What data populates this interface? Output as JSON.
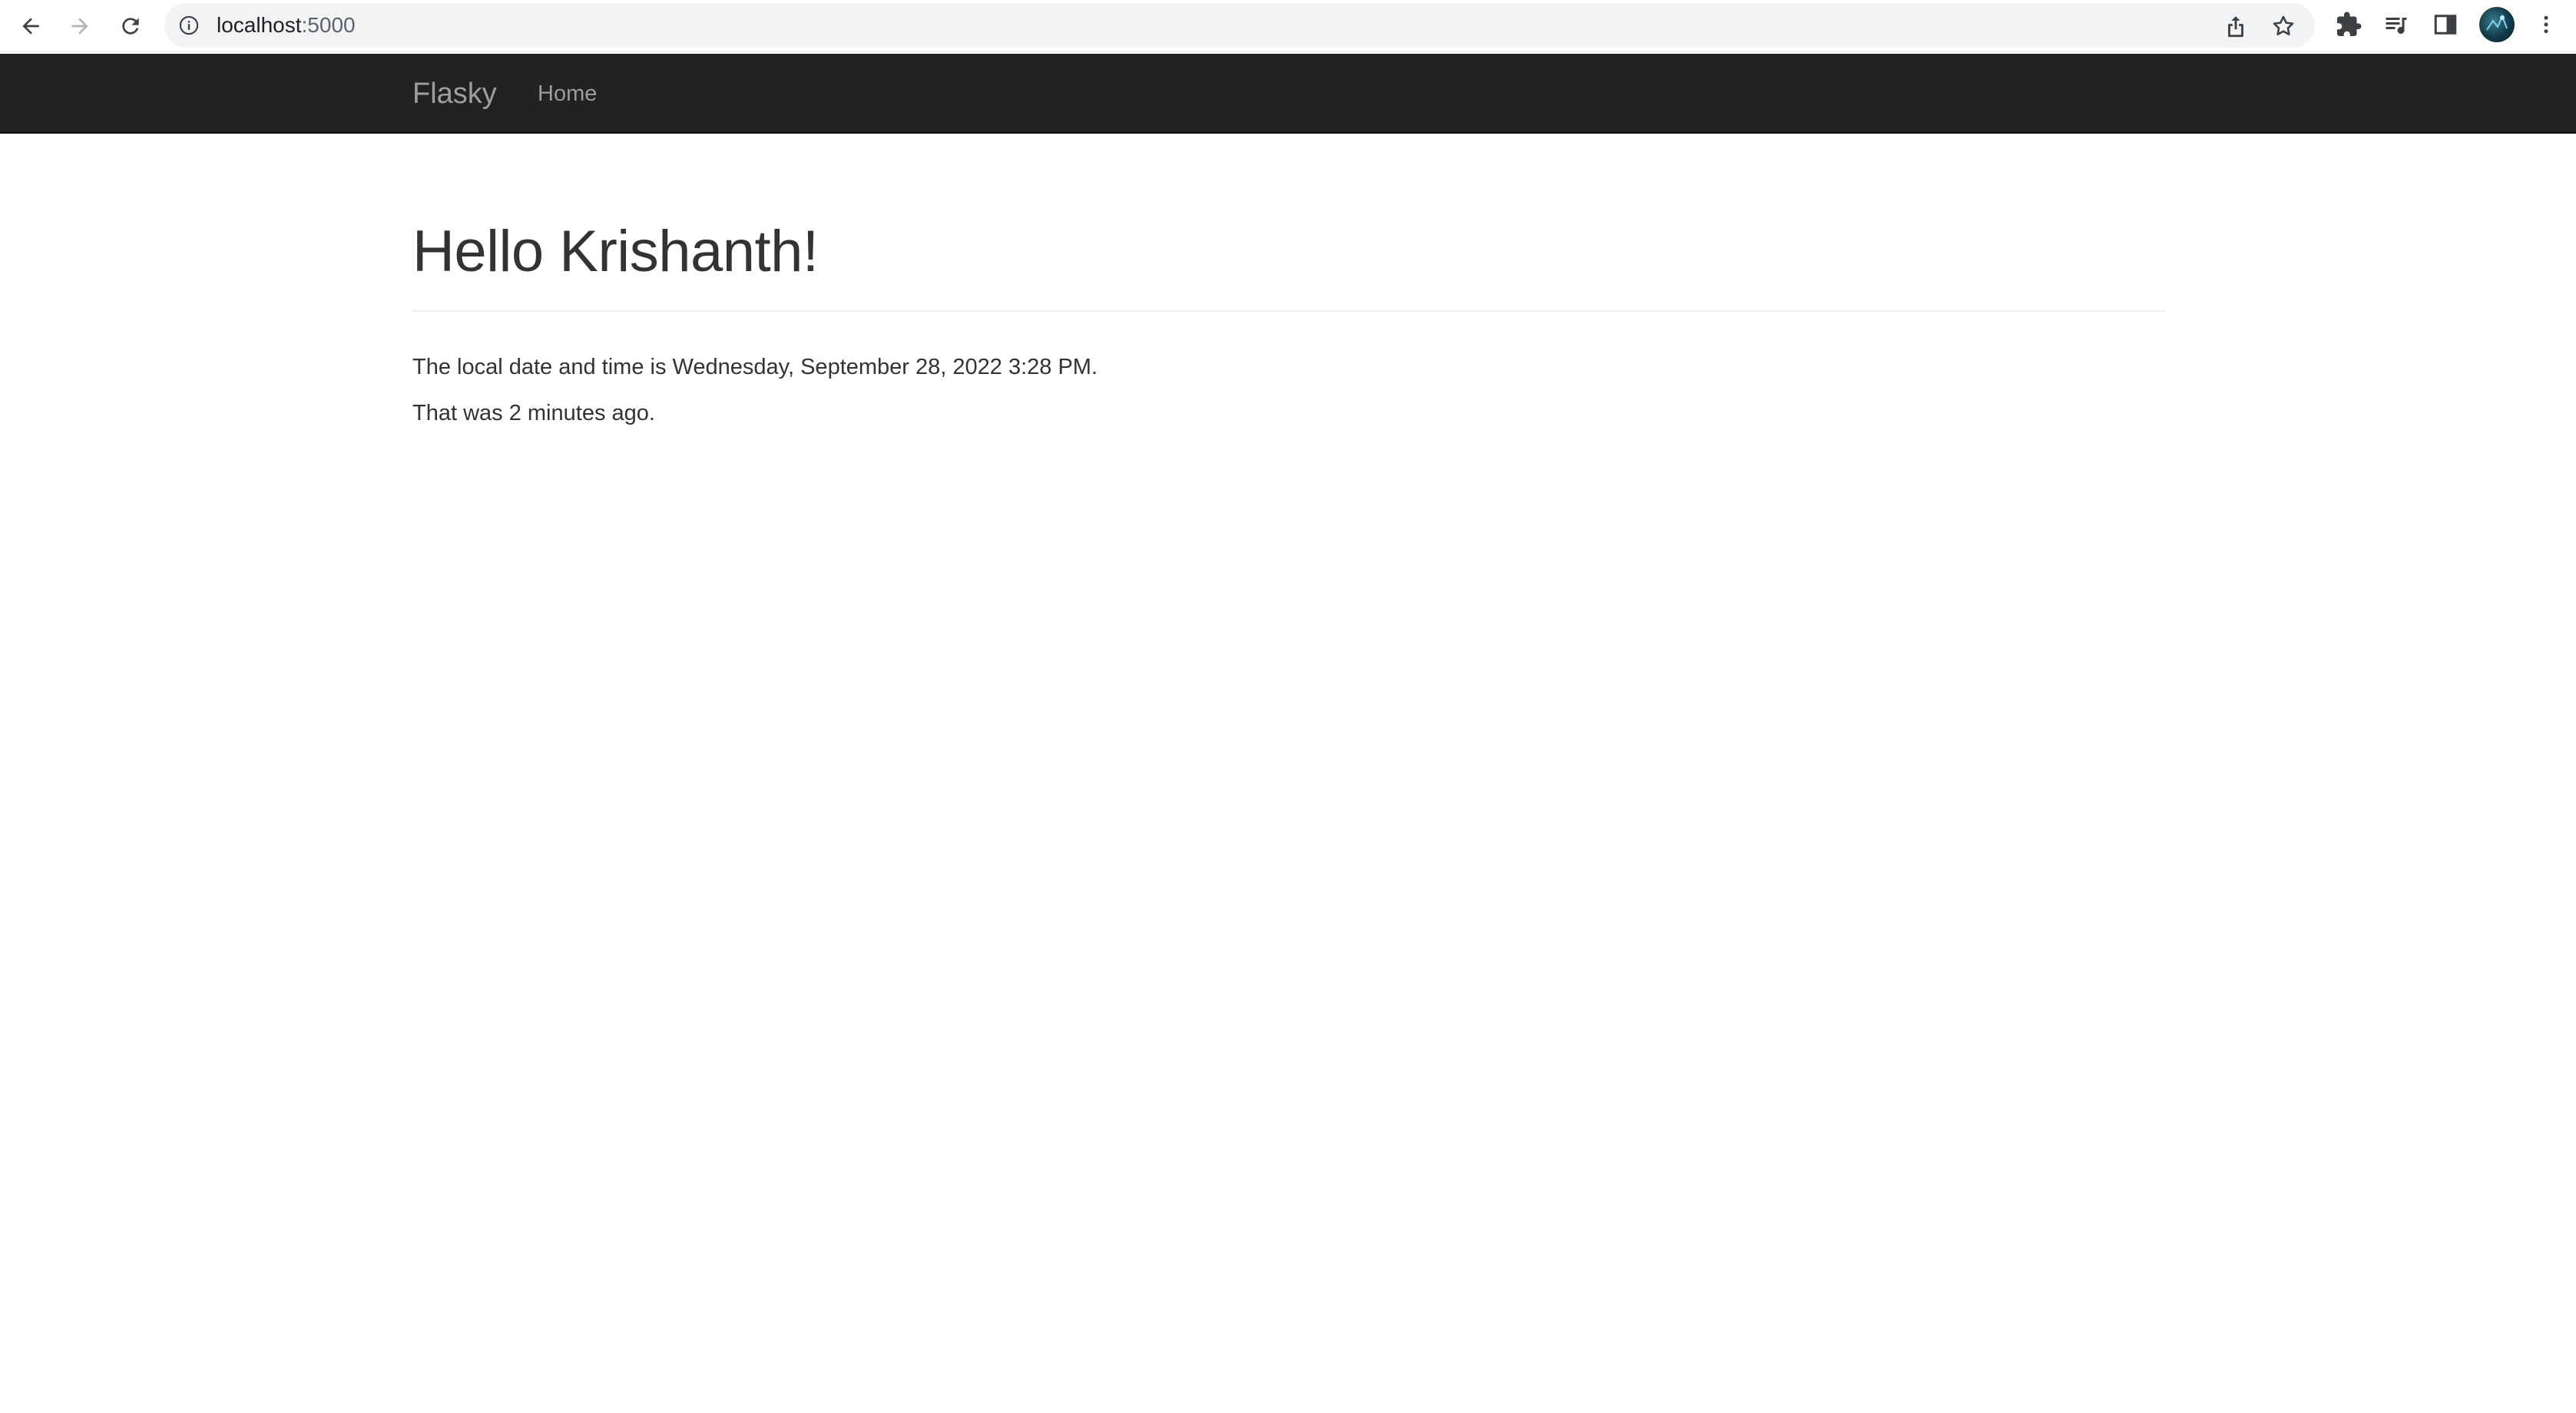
{
  "browser": {
    "url_host": "localhost",
    "url_port": ":5000",
    "icons": {
      "back": "back-arrow-icon",
      "forward": "forward-arrow-icon",
      "reload": "reload-icon",
      "site_info": "info-icon",
      "share": "share-icon",
      "bookmark": "star-icon",
      "extensions": "puzzle-icon",
      "reading_list": "reading-list-icon",
      "side_panel": "side-panel-icon",
      "profile": "avatar",
      "menu": "kebab-menu-icon"
    }
  },
  "navbar": {
    "brand": "Flasky",
    "links": [
      {
        "label": "Home"
      }
    ],
    "background": "#222222",
    "text_color": "#9d9d9d"
  },
  "main": {
    "title": "Hello Krishanth!",
    "datetime_line": "The local date and time is Wednesday, September 28, 2022 3:28 PM.",
    "relative_line": "That was 2 minutes ago."
  }
}
